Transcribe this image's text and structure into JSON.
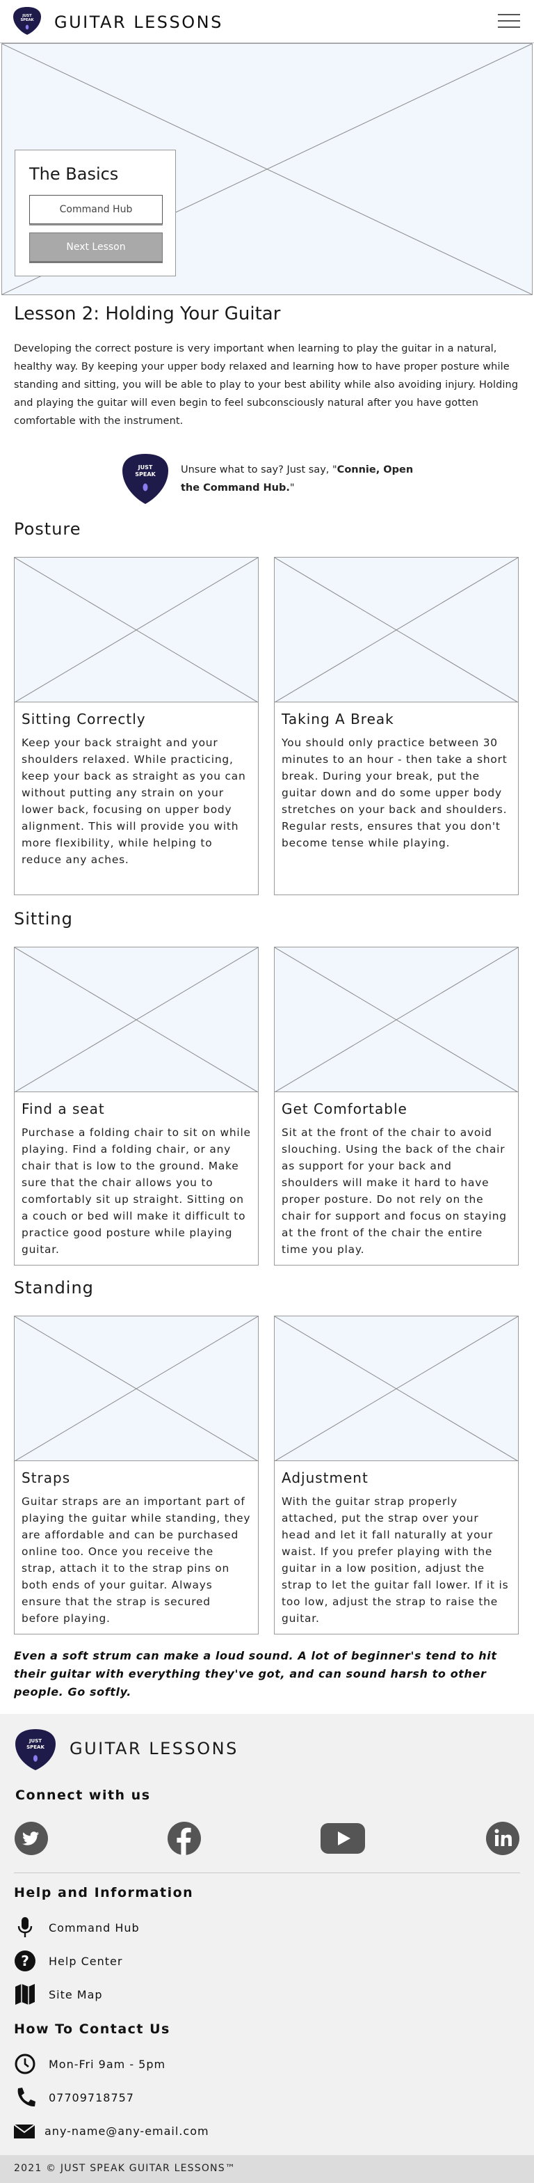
{
  "header": {
    "brand": "GUITAR LESSONS",
    "logo_text_line1": "JUST",
    "logo_text_line2": "SPEAK"
  },
  "hero": {
    "card_title": "The Basics",
    "command_hub_button": "Command Hub",
    "next_lesson_button": "Next Lesson"
  },
  "lesson": {
    "title": "Lesson 2: Holding Your Guitar",
    "intro": "Developing the correct posture is very important when learning to play the guitar in a natural, healthy way. By keeping your upper body relaxed and learning how to have proper posture while standing and sitting, you will be able to play to your best ability while also avoiding injury. Holding and playing the guitar will even begin to feel subconsciously natural after you have gotten comfortable with the instrument.",
    "tip_prefix": "Unsure what to say? Just say, \"",
    "tip_bold": "Connie, Open the Command Hub.",
    "tip_suffix": "\""
  },
  "sections": [
    {
      "heading": "Posture",
      "cards": [
        {
          "title": "Sitting Correctly",
          "text": "Keep your back straight and your shoulders relaxed. While practicing, keep your back as straight as you can without putting any strain on your lower back, focusing on upper body alignment. This will provide you with more flexibility, while helping to reduce any aches."
        },
        {
          "title": "Taking A Break",
          "text": "You should only practice between 30 minutes to an hour - then take a short break. During your break, put the guitar down and do some upper body stretches on your back and shoulders. Regular rests, ensures that you don't become tense while playing."
        }
      ]
    },
    {
      "heading": "Sitting",
      "cards": [
        {
          "title": "Find a seat",
          "text": "Purchase a folding chair to sit on while playing. Find a folding chair, or any chair that is low to the ground. Make sure that the chair allows you to comfortably sit up straight. Sitting on a couch or bed will make it difficult to practice good posture while playing guitar."
        },
        {
          "title": "Get Comfortable",
          "text": "Sit at the front of the chair to avoid slouching. Using the back of the chair as support for your back and shoulders will make it hard to have proper posture. Do not rely on the chair for support and focus on staying at the front of the chair the entire time you play."
        }
      ]
    },
    {
      "heading": "Standing",
      "cards": [
        {
          "title": "Straps",
          "text": "Guitar straps are an important part of playing the guitar while standing, they are affordable and can be purchased online too. Once you receive the strap, attach it to the strap pins on both ends of your guitar. Always ensure that the strap is secured before playing."
        },
        {
          "title": "Adjustment",
          "text": "With the guitar strap properly attached, put the strap over your head and let it fall naturally at your waist. If you prefer playing with the guitar in a low position, adjust the strap to let the guitar fall lower. If it is too low, adjust the strap to raise the guitar."
        }
      ]
    }
  ],
  "quote": "Even a soft strum can make a loud sound. A lot of beginner's tend to hit their guitar with everything they've got, and can sound harsh to other people. Go softly.",
  "footer": {
    "brand": "GUITAR LESSONS",
    "connect_heading": "Connect with us",
    "social_icons": [
      "twitter-icon",
      "facebook-icon",
      "youtube-icon",
      "linkedin-icon"
    ],
    "help_heading": "Help and Information",
    "help_links": [
      "Command Hub",
      "Help Center",
      "Site Map"
    ],
    "contact_heading": "How To Contact Us",
    "hours": "Mon-Fri 9am - 5pm",
    "phone": "07709718757",
    "email": "any-name@any-email.com",
    "copyright": "2021 © JUST SPEAK GUITAR LESSONS™"
  },
  "colors": {
    "logo_bg": "#1e1b4b",
    "placeholder_bg": "#f2f7fd",
    "footer_bg": "#f1f1f1"
  }
}
